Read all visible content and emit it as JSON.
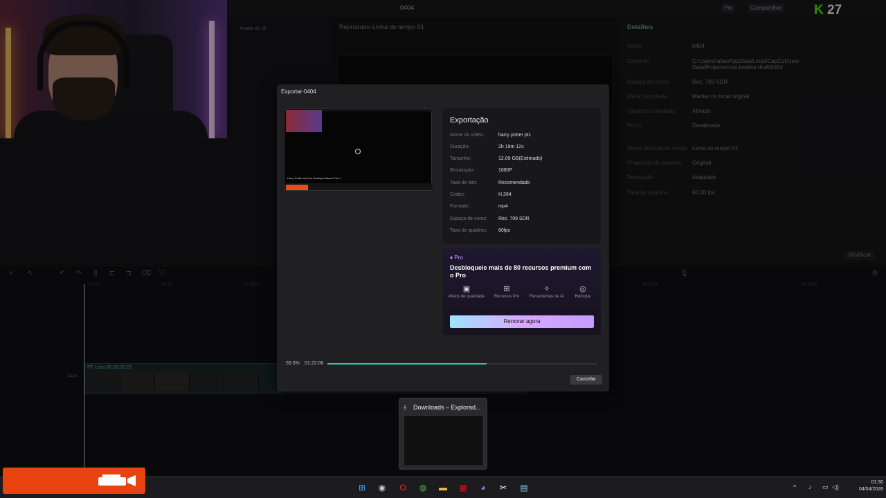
{
  "app": {
    "project_title": "0404",
    "pro_label": "Pro",
    "share_label": "Compartilhar",
    "kick_count": "27"
  },
  "left_panel": {
    "tab_ai_avatar": "Avatar de IA"
  },
  "preview": {
    "title": "Reprodutor-Linha do tempo 01"
  },
  "details": {
    "title": "Detalhes",
    "rows": [
      {
        "k": "Nome",
        "v": "0404"
      },
      {
        "k": "Caminho",
        "v": "C:/Users/rafae/AppData/Local/CapCut/User Data/Projects/com.lveditor.draft/0404"
      },
      {
        "k": "Espaço de cores",
        "v": "Rec. 709 SDR"
      },
      {
        "k": "Mídia importada",
        "v": "Manter no local original"
      },
      {
        "k": "Organizar camadas",
        "v": "Ativado"
      },
      {
        "k": "Proxy",
        "v": "Desativado"
      },
      {
        "k": "Nome da linha do tempo",
        "v": "Linha do tempo 01"
      },
      {
        "k": "Proporção de aspecto",
        "v": "Original"
      },
      {
        "k": "Resolução",
        "v": "Adaptado"
      },
      {
        "k": "Taxa de quadros",
        "v": "60.00 fps"
      }
    ],
    "modify_label": "Modificar"
  },
  "timeline": {
    "ruler": [
      "00:00",
      "00:30",
      "01:00:00",
      "00:30:00",
      "00:30:00"
    ],
    "track_label": "PT Less  00:00:00:21",
    "cover_label": "Capa"
  },
  "dialog": {
    "title": "Exportar-0404",
    "heading": "Exportação",
    "thumb_caption": "Harry Potter and the Deathly Hallows Part 1",
    "rows": [
      {
        "k": "Nome do vídeo:",
        "v": "harry potter pt1"
      },
      {
        "k": "Duração:",
        "v": "2h 19m 12s"
      },
      {
        "k": "Tamanho:",
        "v": "12.09 GB(Estimado)"
      },
      {
        "k": "Resolução:",
        "v": "1080P"
      },
      {
        "k": "Taxa de bits:",
        "v": "Recomendado"
      },
      {
        "k": "Codec:",
        "v": "H.264"
      },
      {
        "k": "Formato:",
        "v": "mp4"
      },
      {
        "k": "Espaço de cores:",
        "v": "Rec. 709 SDR"
      },
      {
        "k": "Taxa de quadros:",
        "v": "60fps"
      }
    ],
    "promo": {
      "pro_label": "Pro",
      "text": "Desbloqueie mais de 80 recursos premium com o Pro",
      "features": [
        {
          "icon": "image-quality-icon",
          "label": "Ativos de qualidade"
        },
        {
          "icon": "grid-icon",
          "label": "Recursos Pro"
        },
        {
          "icon": "magic-wand-icon",
          "label": "Ferramentas de IA"
        },
        {
          "icon": "retouch-icon",
          "label": "Retoque"
        }
      ],
      "renew_label": "Renovar agora"
    },
    "progress": {
      "percent_label": "59.0%",
      "percent_value": 59.0,
      "elapsed": "01:22:06"
    },
    "cancel_label": "Cancelar"
  },
  "taskbar_preview": {
    "title": "Downloads – Explorad..."
  },
  "taskbar": {
    "time": "01:30",
    "date": "04/04/2026",
    "apps": [
      "windows-start-icon",
      "steam-icon",
      "opera-icon",
      "chrome-icon",
      "file-explorer-icon",
      "netflix-icon",
      "discord-icon",
      "capcut-icon",
      "notepad-icon"
    ]
  },
  "colors": {
    "accent": "#2ec4b6",
    "brand_orange": "#e8420e",
    "kick_green": "#53fc18"
  }
}
